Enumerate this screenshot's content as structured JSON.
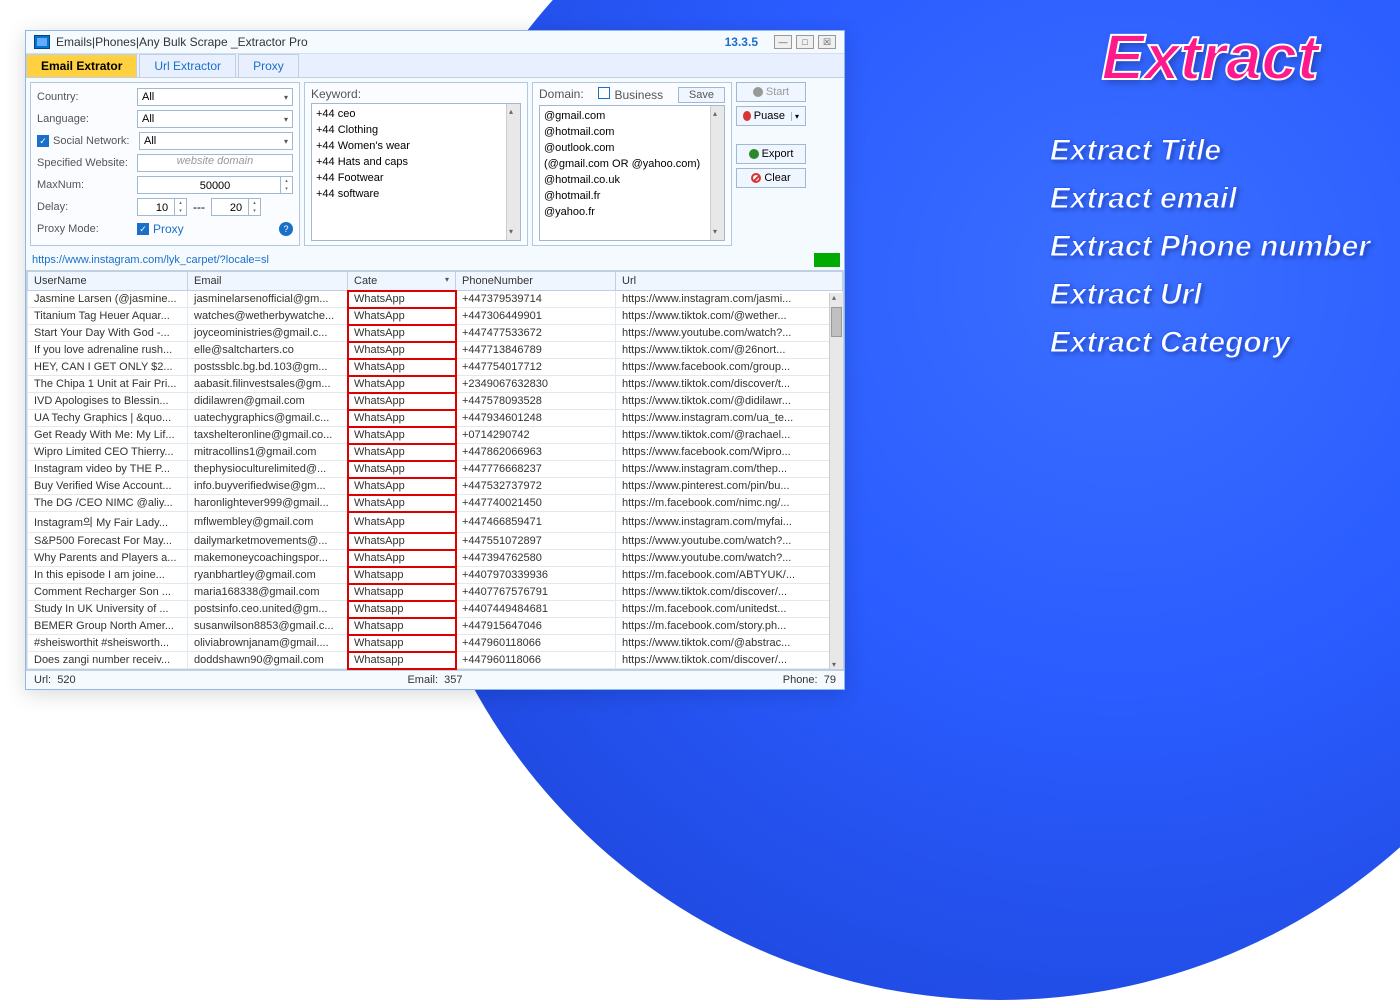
{
  "window": {
    "title": "Emails|Phones|Any Bulk Scrape _Extractor Pro",
    "version": "13.3.5"
  },
  "tabs": {
    "email": "Email Extrator",
    "url": "Url Extractor",
    "proxy": "Proxy"
  },
  "filters": {
    "country_label": "Country:",
    "country_value": "All",
    "language_label": "Language:",
    "language_value": "All",
    "social_label": "Social Network:",
    "social_value": "All",
    "website_label": "Specified Website:",
    "website_placeholder": "website domain",
    "maxnum_label": "MaxNum:",
    "maxnum_value": "50000",
    "delay_label": "Delay:",
    "delay_from": "10",
    "delay_sep": "---",
    "delay_to": "20",
    "proxymode_label": "Proxy Mode:",
    "proxymode_value": "Proxy"
  },
  "keywords": {
    "label": "Keyword:",
    "items": [
      "+44 ceo",
      "+44  Clothing",
      "+44 Women's wear",
      "+44  Hats and caps",
      "+44 Footwear",
      "+44 software"
    ]
  },
  "domains": {
    "label": "Domain:",
    "business": "Business",
    "save": "Save",
    "items": [
      "@gmail.com",
      "@hotmail.com",
      "@outlook.com",
      "(@gmail.com OR @yahoo.com)",
      "@hotmail.co.uk",
      "@hotmail.fr",
      "@yahoo.fr"
    ]
  },
  "buttons": {
    "start": "Start",
    "pause": "Puase",
    "export": "Export",
    "clear": "Clear"
  },
  "urlbar": "https://www.instagram.com/lyk_carpet/?locale=sl",
  "columns": {
    "user": "UserName",
    "email": "Email",
    "cate": "Cate",
    "phone": "PhoneNumber",
    "url": "Url"
  },
  "rows": [
    {
      "u": "Jasmine Larsen (@jasmine...",
      "e": "jasminelarsenofficial@gm...",
      "c": "WhatsApp",
      "p": "+447379539714",
      "url": "https://www.instagram.com/jasmi..."
    },
    {
      "u": "Titanium Tag Heuer Aquar...",
      "e": "watches@wetherbywatche...",
      "c": "WhatsApp",
      "p": "+447306449901",
      "url": "https://www.tiktok.com/@wether..."
    },
    {
      "u": "Start Your Day With God -...",
      "e": "joyceoministries@gmail.c...",
      "c": "WhatsApp",
      "p": "+447477533672",
      "url": "https://www.youtube.com/watch?..."
    },
    {
      "u": "If you love adrenaline rush...",
      "e": "elle@saltcharters.co",
      "c": "WhatsApp",
      "p": "+447713846789",
      "url": "https://www.tiktok.com/@26nort..."
    },
    {
      "u": "HEY, CAN I GET ONLY $2...",
      "e": "postssblc.bg.bd.103@gm...",
      "c": "WhatsApp",
      "p": "+447754017712",
      "url": "https://www.facebook.com/group..."
    },
    {
      "u": "The Chipa 1 Unit at Fair Pri...",
      "e": "aabasit.filinvestsales@gm...",
      "c": "WhatsApp",
      "p": "+2349067632830",
      "url": "https://www.tiktok.com/discover/t..."
    },
    {
      "u": "IVD Apologises to Blessin...",
      "e": "didilawren@gmail.com",
      "c": "WhatsApp",
      "p": "+447578093528",
      "url": "https://www.tiktok.com/@didilawr..."
    },
    {
      "u": "UA Techy Graphics | &quo...",
      "e": "uatechygraphics@gmail.c...",
      "c": "WhatsApp",
      "p": "+447934601248",
      "url": "https://www.instagram.com/ua_te..."
    },
    {
      "u": "Get Ready With Me: My Lif...",
      "e": "taxshelteronline@gmail.co...",
      "c": "WhatsApp",
      "p": "+0714290742",
      "url": "https://www.tiktok.com/@rachael..."
    },
    {
      "u": "Wipro Limited CEO Thierry...",
      "e": "mitracollins1@gmail.com",
      "c": "WhatsApp",
      "p": "+447862066963",
      "url": "https://www.facebook.com/Wipro..."
    },
    {
      "u": "Instagram video by THE P...",
      "e": "thephysioculturelimited@...",
      "c": "WhatsApp",
      "p": "+447776668237",
      "url": "https://www.instagram.com/thep..."
    },
    {
      "u": "Buy Verified Wise Account...",
      "e": "info.buyverifiedwise@gm...",
      "c": "WhatsApp",
      "p": "+447532737972",
      "url": "https://www.pinterest.com/pin/bu..."
    },
    {
      "u": "The DG /CEO NIMC @aliy...",
      "e": "haronlightever999@gmail...",
      "c": "WhatsApp",
      "p": "+447740021450",
      "url": "https://m.facebook.com/nimc.ng/..."
    },
    {
      "u": "Instagram의 My Fair Lady...",
      "e": "mflwembley@gmail.com",
      "c": "WhatsApp",
      "p": "+447466859471",
      "url": "https://www.instagram.com/myfai..."
    },
    {
      "u": "S&P500 Forecast For May...",
      "e": "dailymarketmovements@...",
      "c": "WhatsApp",
      "p": "+447551072897",
      "url": "https://www.youtube.com/watch?..."
    },
    {
      "u": "Why Parents and Players a...",
      "e": "makemoneycoachingspor...",
      "c": "WhatsApp",
      "p": "+447394762580",
      "url": "https://www.youtube.com/watch?..."
    },
    {
      "u": "In this episode I am joine...",
      "e": "ryanbhartley@gmail.com",
      "c": "Whatsapp",
      "p": "+4407970339936",
      "url": "https://m.facebook.com/ABTYUK/..."
    },
    {
      "u": "Comment Recharger Son ...",
      "e": "maria168338@gmail.com",
      "c": "Whatsapp",
      "p": "+4407767576791",
      "url": "https://www.tiktok.com/discover/..."
    },
    {
      "u": "Study In UK University of ...",
      "e": "postsinfo.ceo.united@gm...",
      "c": "Whatsapp",
      "p": "+4407449484681",
      "url": "https://m.facebook.com/unitedst..."
    },
    {
      "u": "BEMER Group North Amer...",
      "e": "susanwilson8853@gmail.c...",
      "c": "Whatsapp",
      "p": "+447915647046",
      "url": "https://m.facebook.com/story.ph..."
    },
    {
      "u": "#sheisworthit #sheisworth...",
      "e": "oliviabrownjanam@gmail....",
      "c": "Whatsapp",
      "p": "+447960118066",
      "url": "https://www.tiktok.com/@abstrac..."
    },
    {
      "u": "Does zangi number receiv...",
      "e": "doddshawn90@gmail.com",
      "c": "Whatsapp",
      "p": "+447960118066",
      "url": "https://www.tiktok.com/discover/..."
    }
  ],
  "status": {
    "url_label": "Url:",
    "url_count": "520",
    "email_label": "Email:",
    "email_count": "357",
    "phone_label": "Phone:",
    "phone_count": "79"
  },
  "side": {
    "title": "Extract",
    "i1": "Extract Title",
    "i2": "Extract email",
    "i3": "Extract Phone number",
    "i4": "Extract Url",
    "i5": "Extract Category"
  }
}
